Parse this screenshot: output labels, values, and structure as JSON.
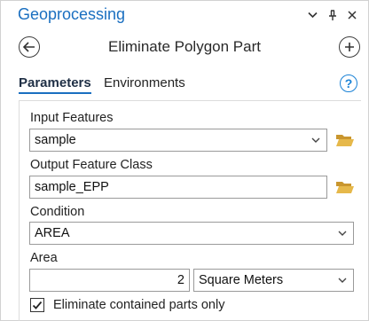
{
  "titlebar": {
    "title": "Geoprocessing",
    "controls": [
      "chevron-down-icon",
      "pin-icon",
      "close-icon"
    ]
  },
  "tool": {
    "name": "Eliminate Polygon Part",
    "back_icon": "back-arrow-icon",
    "add_icon": "add-icon"
  },
  "tabs": [
    {
      "label": "Parameters",
      "active": true
    },
    {
      "label": "Environments",
      "active": false
    }
  ],
  "help_label": "?",
  "params": {
    "input_features": {
      "label": "Input Features",
      "value": "sample"
    },
    "output_feature_class": {
      "label": "Output Feature Class",
      "value": "sample_EPP"
    },
    "condition": {
      "label": "Condition",
      "value": "AREA"
    },
    "area": {
      "label": "Area",
      "value": "2",
      "unit": "Square Meters"
    },
    "eliminate_contained": {
      "label": "Eliminate contained parts only",
      "checked": true
    }
  },
  "colors": {
    "accent": "#1a6fc0",
    "folder": "#e6b84a"
  }
}
